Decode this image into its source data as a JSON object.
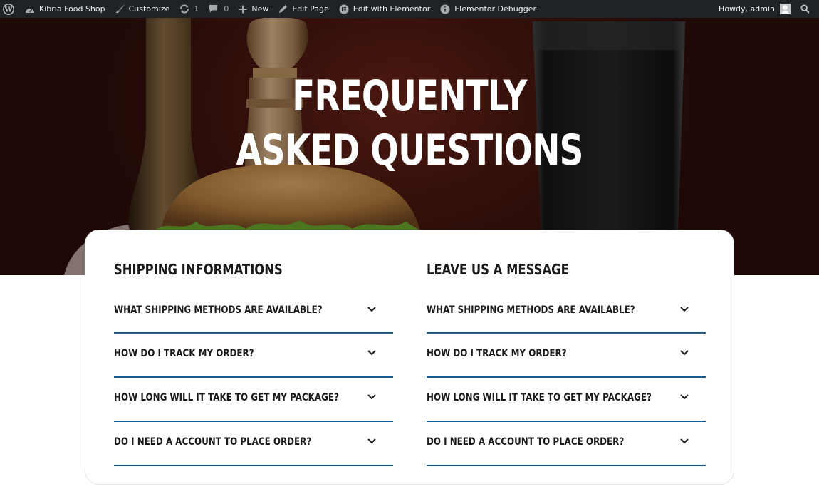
{
  "adminbar": {
    "site_name": "Kibria Food Shop",
    "customize": "Customize",
    "updates_count": "1",
    "comments_count": "0",
    "new": "New",
    "edit_page": "Edit Page",
    "edit_elementor": "Edit with Elementor",
    "debugger": "Elementor Debugger",
    "howdy": "Howdy, admin"
  },
  "hero": {
    "title_line1": "FREQUENTLY",
    "title_line2": "ASKED QUESTIONS"
  },
  "faq": {
    "left": {
      "title": "SHIPPING INFORMATIONS",
      "items": [
        "WHAT SHIPPING METHODS ARE AVAILABLE?",
        "HOW DO I TRACK MY ORDER?",
        "HOW LONG WILL IT TAKE TO GET MY PACKAGE?",
        "DO I NEED A ACCOUNT TO PLACE ORDER?"
      ]
    },
    "right": {
      "title": "LEAVE US A MESSAGE",
      "items": [
        "WHAT SHIPPING METHODS ARE AVAILABLE?",
        "HOW DO I TRACK MY ORDER?",
        "HOW LONG WILL IT TAKE TO GET MY PACKAGE?",
        "DO I NEED A ACCOUNT TO PLACE ORDER?"
      ]
    }
  },
  "colors": {
    "adminbar_bg": "#1d2327",
    "accent_underline": "#1e5a8a",
    "hero_bg": "#4a1710"
  },
  "icons": [
    "wordpress-icon",
    "dashboard-icon",
    "brush-icon",
    "updates-icon",
    "comment-icon",
    "plus-icon",
    "pencil-icon",
    "elementor-icon",
    "info-icon",
    "avatar",
    "search-icon",
    "chevron-down-icon"
  ]
}
